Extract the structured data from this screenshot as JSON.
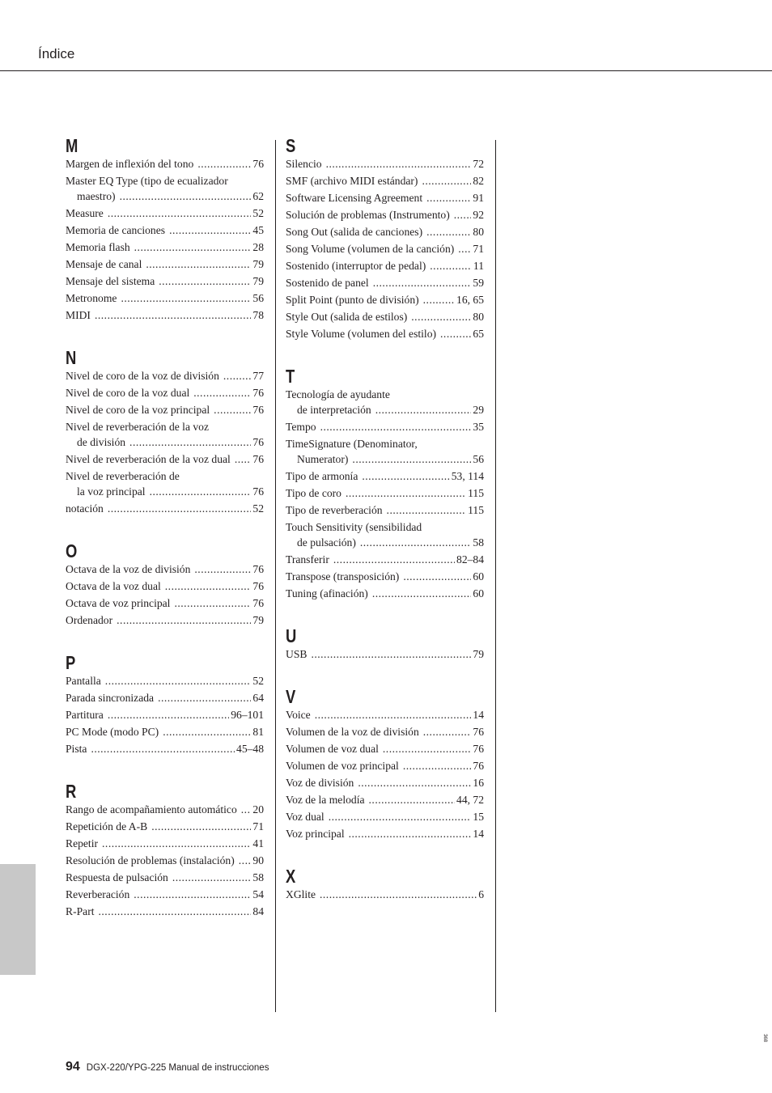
{
  "header": {
    "title": "Índice"
  },
  "columns": [
    [
      {
        "letter": "M",
        "entries": [
          {
            "text": "Margen de inflexión del tono",
            "page": "76"
          },
          {
            "text": "Master EQ Type (tipo de ecualizador",
            "cont": "maestro)",
            "page": "62"
          },
          {
            "text": "Measure",
            "page": "52"
          },
          {
            "text": "Memoria de canciones",
            "page": "45"
          },
          {
            "text": "Memoria flash",
            "page": "28"
          },
          {
            "text": "Mensaje de canal",
            "page": "79"
          },
          {
            "text": "Mensaje del sistema",
            "page": "79"
          },
          {
            "text": "Metronome",
            "page": "56"
          },
          {
            "text": "MIDI",
            "page": "78"
          }
        ]
      },
      {
        "letter": "N",
        "entries": [
          {
            "text": "Nivel de coro de la voz de división",
            "page": "77"
          },
          {
            "text": "Nivel de coro de la voz dual",
            "page": "76"
          },
          {
            "text": "Nivel de coro de la voz principal",
            "page": "76"
          },
          {
            "text": "Nivel de reverberación de la voz",
            "cont": "de división",
            "page": "76"
          },
          {
            "text": "Nivel de reverberación de la voz dual",
            "page": "76"
          },
          {
            "text": "Nivel de reverberación de",
            "cont": "la voz principal",
            "page": "76"
          },
          {
            "text": "notación",
            "page": "52"
          }
        ]
      },
      {
        "letter": "O",
        "entries": [
          {
            "text": "Octava de la voz de división",
            "page": "76"
          },
          {
            "text": "Octava de la voz dual",
            "page": "76"
          },
          {
            "text": "Octava de voz principal",
            "page": "76"
          },
          {
            "text": "Ordenador",
            "page": "79"
          }
        ]
      },
      {
        "letter": "P",
        "entries": [
          {
            "text": "Pantalla",
            "page": "52"
          },
          {
            "text": "Parada sincronizada",
            "page": "64"
          },
          {
            "text": "Partitura",
            "page": "96–101"
          },
          {
            "text": "PC Mode (modo PC)",
            "page": "81"
          },
          {
            "text": "Pista",
            "page": "45–48"
          }
        ]
      },
      {
        "letter": "R",
        "entries": [
          {
            "text": "Rango de acompañamiento automático",
            "page": "20"
          },
          {
            "text": "Repetición de A-B",
            "page": "71"
          },
          {
            "text": "Repetir",
            "page": "41"
          },
          {
            "text": "Resolución de problemas (instalación)",
            "page": "90"
          },
          {
            "text": "Respuesta de pulsación",
            "page": "58"
          },
          {
            "text": "Reverberación",
            "page": "54"
          },
          {
            "text": "R-Part",
            "page": "84"
          }
        ]
      }
    ],
    [
      {
        "letter": "S",
        "entries": [
          {
            "text": "Silencio",
            "page": "72"
          },
          {
            "text": "SMF (archivo MIDI estándar)",
            "page": "82"
          },
          {
            "text": "Software Licensing Agreement",
            "page": "91"
          },
          {
            "text": "Solución de problemas (Instrumento)",
            "page": "92"
          },
          {
            "text": "Song Out (salida de canciones)",
            "page": "80"
          },
          {
            "text": "Song Volume (volumen de la canción)",
            "page": "71"
          },
          {
            "text": "Sostenido (interruptor de pedal)",
            "page": "11"
          },
          {
            "text": "Sostenido de panel",
            "page": "59"
          },
          {
            "text": "Split Point (punto de división)",
            "page": "16, 65"
          },
          {
            "text": "Style Out (salida de estilos)",
            "page": "80"
          },
          {
            "text": "Style Volume (volumen del estilo)",
            "page": "65"
          }
        ]
      },
      {
        "letter": "T",
        "entries": [
          {
            "text": "Tecnología de ayudante",
            "cont": "de interpretación",
            "page": "29"
          },
          {
            "text": "Tempo",
            "page": "35"
          },
          {
            "text": "TimeSignature (Denominator,",
            "cont": "Numerator)",
            "page": "56"
          },
          {
            "text": "Tipo de armonía",
            "page": "53, 114"
          },
          {
            "text": "Tipo de coro",
            "page": "115"
          },
          {
            "text": "Tipo de reverberación",
            "page": "115"
          },
          {
            "text": "Touch Sensitivity (sensibilidad",
            "cont": "de pulsación)",
            "page": "58"
          },
          {
            "text": "Transferir",
            "page": "82–84"
          },
          {
            "text": "Transpose (transposición)",
            "page": "60"
          },
          {
            "text": "Tuning (afinación)",
            "page": "60"
          }
        ]
      },
      {
        "letter": "U",
        "entries": [
          {
            "text": "USB",
            "page": "79"
          }
        ]
      },
      {
        "letter": "V",
        "entries": [
          {
            "text": "Voice",
            "page": "14"
          },
          {
            "text": "Volumen de la voz de división",
            "page": "76"
          },
          {
            "text": "Volumen de voz dual",
            "page": "76"
          },
          {
            "text": "Volumen de voz principal",
            "page": "76"
          },
          {
            "text": "Voz de división",
            "page": "16"
          },
          {
            "text": "Voz de la melodía",
            "page": "44, 72"
          },
          {
            "text": "Voz dual",
            "page": "15"
          },
          {
            "text": "Voz principal",
            "page": "14"
          }
        ]
      },
      {
        "letter": "X",
        "entries": [
          {
            "text": "XGlite",
            "page": "6"
          }
        ]
      }
    ]
  ],
  "footer": {
    "page_number": "94",
    "title": "DGX-220/YPG-225  Manual de instrucciones",
    "code": "368"
  }
}
